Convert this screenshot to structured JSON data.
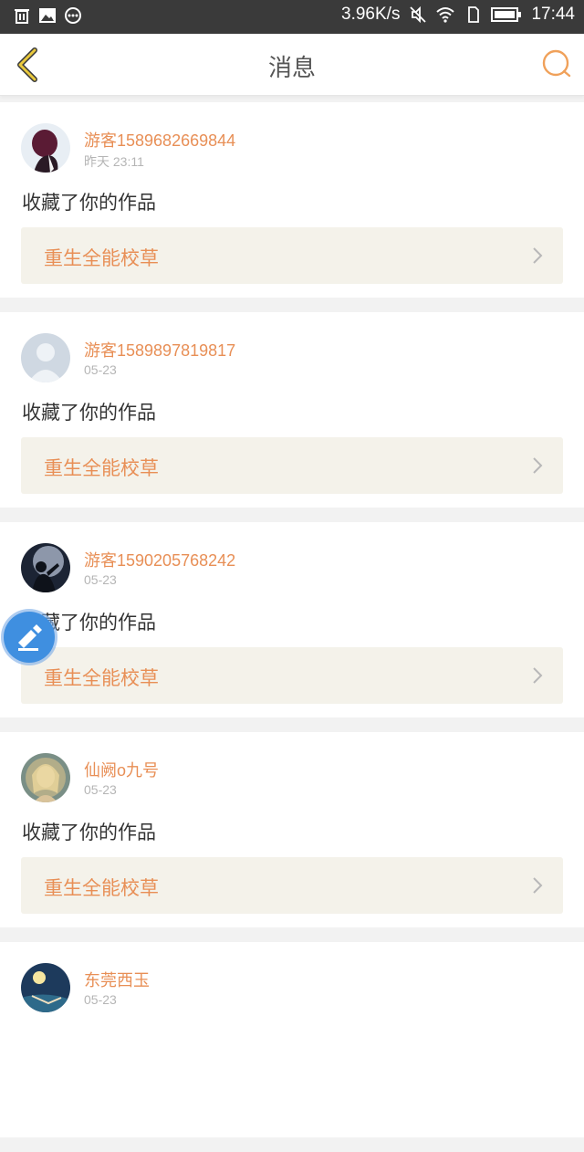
{
  "status_bar": {
    "net_speed": "3.96K/s",
    "time": "17:44",
    "icons": [
      "trash-icon",
      "image-icon",
      "more-icon",
      "mute-icon",
      "wifi-icon",
      "sim-icon",
      "battery-icon"
    ]
  },
  "header": {
    "title": "消息",
    "back_icon": "chevron-left-icon",
    "search_icon": "search-icon"
  },
  "colors": {
    "accent": "#e88f56",
    "back_icon": "#e9c93d",
    "work_bg": "#f4f2ea"
  },
  "messages": [
    {
      "username": "游客1589682669844",
      "time": "昨天 23:11",
      "action": "收藏了你的作品",
      "work": "重生全能校草"
    },
    {
      "username": "游客1589897819817",
      "time": "05-23",
      "action": "收藏了你的作品",
      "work": "重生全能校草"
    },
    {
      "username": "游客1590205768242",
      "time": "05-23",
      "action": "收藏了你的作品",
      "work": "重生全能校草"
    },
    {
      "username": "仙阙o九号",
      "time": "05-23",
      "action": "收藏了你的作品",
      "work": "重生全能校草"
    },
    {
      "username": "东莞西玉",
      "time": "05-23",
      "action": "",
      "work": ""
    }
  ]
}
